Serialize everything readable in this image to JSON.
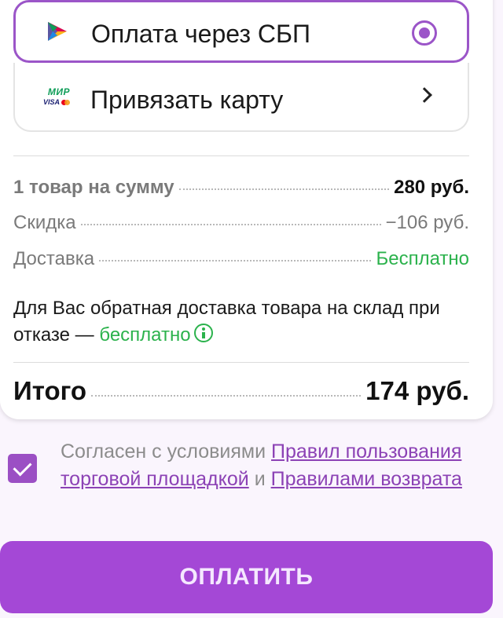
{
  "payment_methods": {
    "sbp_label": "Оплата через СБП",
    "card_label": "Привязать карту",
    "card_logo_mir": "МИР",
    "card_logo_visa": "VISA"
  },
  "summary": {
    "items_label": "1 товар на сумму",
    "items_value": "280 руб.",
    "discount_label": "Скидка",
    "discount_value": "−106 руб.",
    "delivery_label": "Доставка",
    "delivery_value": "Бесплатно",
    "return_text": "Для Вас обратная доставка товара на склад при отказе —",
    "return_free": "бесплатно",
    "total_label": "Итого",
    "total_value": "174 руб."
  },
  "agreement": {
    "checked": true,
    "text_prefix": "Согласен с условиями",
    "link_rules": "Правил пользования торговой площадкой",
    "text_and": "и",
    "link_return": "Правилами возврата"
  },
  "pay_button_label": "ОПЛАТИТЬ",
  "colors": {
    "accent": "#9b55c8",
    "button": "#a448d6",
    "green": "#2bb24c"
  }
}
